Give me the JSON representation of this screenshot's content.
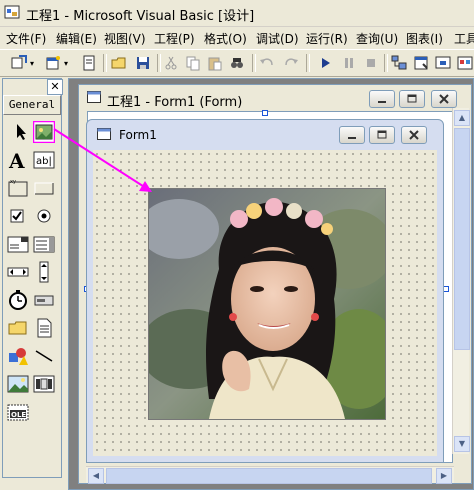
{
  "app": {
    "title": "工程1 - Microsoft Visual Basic [设计]"
  },
  "menu": [
    "文件(F)",
    "编辑(E)",
    "视图(V)",
    "工程(P)",
    "格式(O)",
    "调试(D)",
    "运行(R)",
    "查询(U)",
    "图表(I)",
    "工具"
  ],
  "toolbox": {
    "title": "General",
    "close": "✕"
  },
  "form_window": {
    "title": "工程1 - Form1 (Form)"
  },
  "form1": {
    "title": "Form1"
  },
  "colors": {
    "highlight_arrow": "#ff00ff",
    "form_title_bg": "#d5ddf0",
    "accent": "#1b55d8"
  }
}
